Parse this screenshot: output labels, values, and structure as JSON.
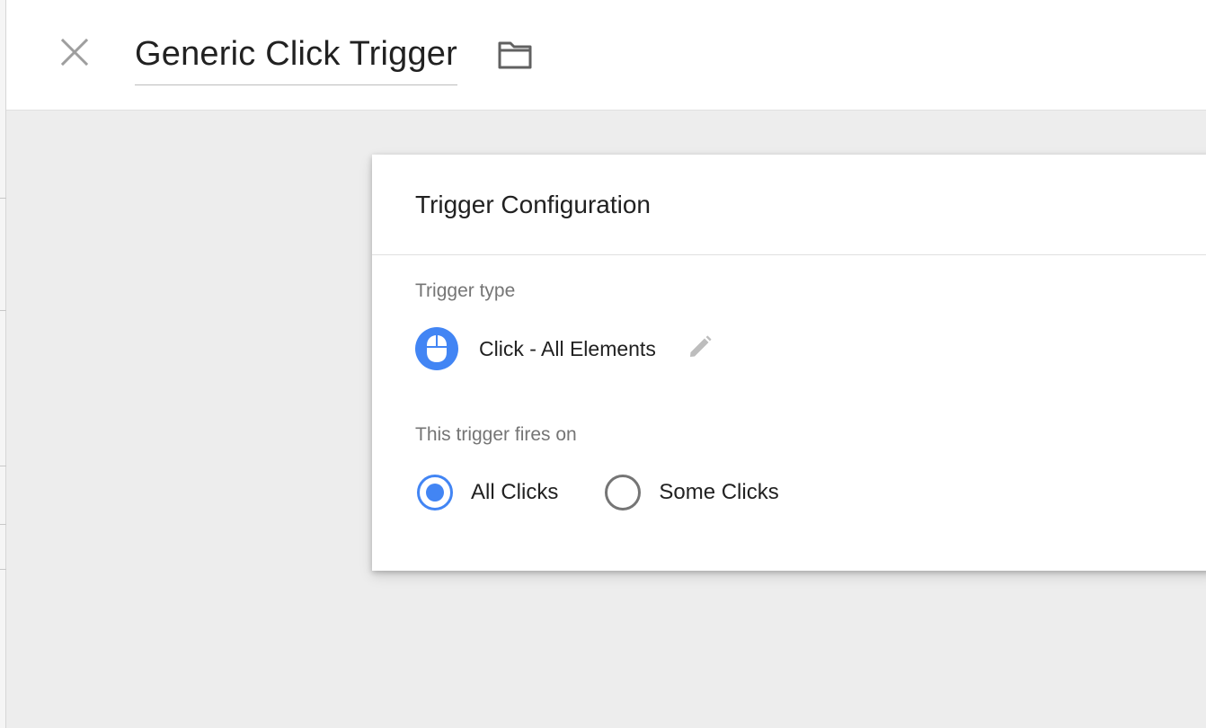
{
  "header": {
    "title": "Generic Click Trigger",
    "close_icon": "close-icon",
    "folder_icon": "folder-icon"
  },
  "card": {
    "title": "Trigger Configuration",
    "trigger_type_label": "Trigger type",
    "trigger_type": {
      "name": "Click - All Elements",
      "icon": "mouse-icon",
      "edit_icon": "pencil-icon"
    },
    "fires_on_label": "This trigger fires on",
    "fires_on_options": [
      {
        "label": "All Clicks",
        "selected": true
      },
      {
        "label": "Some Clicks",
        "selected": false
      }
    ]
  },
  "colors": {
    "accent": "#4285f4",
    "background": "#ededed",
    "text_secondary": "#757575"
  }
}
